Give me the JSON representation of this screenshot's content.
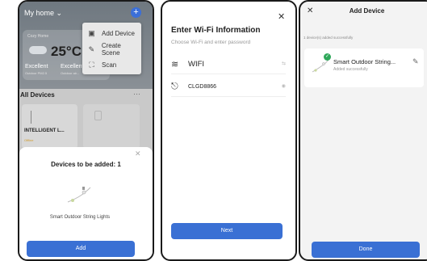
{
  "panel1": {
    "home_title": "My home ⌄",
    "weather": {
      "label": "Cozy Home",
      "temperature": "25°C",
      "outdoor_label_1": "Excellent",
      "outdoor_sub_1": "Outdoor PM2.5",
      "outdoor_label_2": "Excellent",
      "outdoor_sub_2": "Outdoor air..."
    },
    "menu": {
      "items": [
        {
          "label": "Add Device",
          "icon": "add-device-icon"
        },
        {
          "label": "Create Scene",
          "icon": "create-scene-icon"
        },
        {
          "label": "Scan",
          "icon": "scan-icon"
        }
      ]
    },
    "section_title": "All Devices",
    "section_more": "···",
    "device_card": {
      "name": "INTELLIGENT L...",
      "status": "Offline"
    },
    "sheet": {
      "title": "Devices to be added: 1",
      "device_name": "Smart Outdoor String Lights",
      "add_button": "Add"
    }
  },
  "panel2": {
    "title": "Enter Wi-Fi Information",
    "subtitle": "Choose Wi-Fi and enter password",
    "wifi_name": "WIFI",
    "wifi_trail": "⇆",
    "password": "CLGD8866",
    "next_button": "Next"
  },
  "panel3": {
    "title": "Add Device",
    "count_text": "1 device(s) added successfully",
    "device_name": "Smart Outdoor String...",
    "device_status": "Added successfully",
    "done_button": "Done"
  },
  "colors": {
    "accent": "#3a70d4",
    "success": "#2fa85a",
    "offline": "#d09a2a"
  }
}
